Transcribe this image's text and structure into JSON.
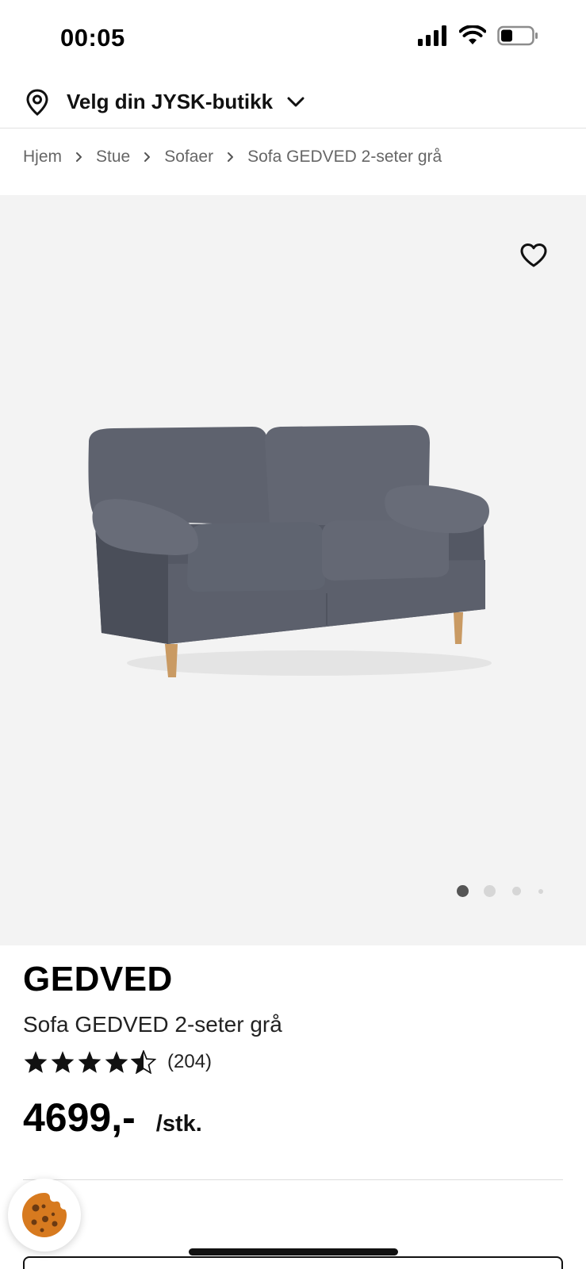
{
  "status_bar": {
    "time": "00:05",
    "icons": [
      "cellular-signal-icon",
      "wifi-icon",
      "battery-icon"
    ]
  },
  "store_selector": {
    "icon": "location-pin-icon",
    "label": "Velg din JYSK-butikk",
    "chevron_icon": "chevron-down-icon"
  },
  "breadcrumb": {
    "items": [
      "Hjem",
      "Stue",
      "Sofaer",
      "Sofa GEDVED 2-seter grå"
    ],
    "separator_icon": "chevron-right-icon"
  },
  "gallery": {
    "favorite_icon": "heart-outline-icon",
    "image": "sofa-product-image",
    "page_count": 4,
    "active_index": 0
  },
  "product": {
    "brand": "GEDVED",
    "name": "Sofa GEDVED 2-seter grå",
    "rating": 4.5,
    "rating_max": 5,
    "rating_count": "(204)",
    "price": "4699,-",
    "unit": "/stk."
  },
  "cookie_button": {
    "icon": "cookie-icon"
  },
  "colors": {
    "gallery_bg": "#f3f3f3",
    "text": "#111111",
    "muted": "#666666",
    "sofa_fabric": "#5b5f6b",
    "cookie": "#d77a1f"
  }
}
